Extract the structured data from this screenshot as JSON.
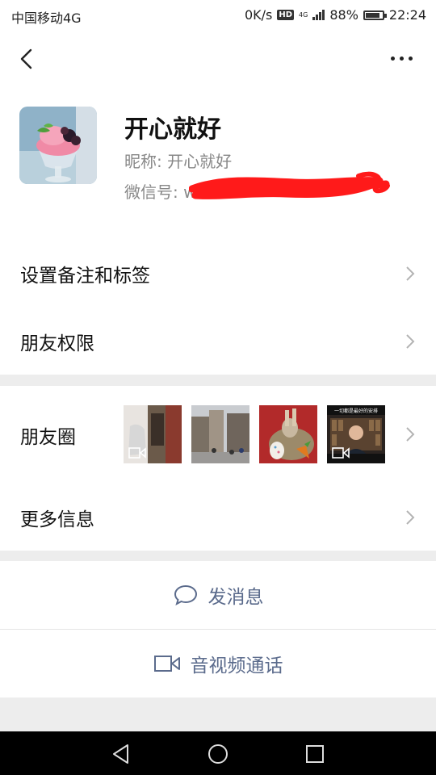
{
  "status_bar": {
    "carrier": "中国移动4G",
    "speed": "0K/s",
    "hd": "HD",
    "network": "4G",
    "battery": "88%",
    "time": "22:24"
  },
  "profile": {
    "name": "开心就好",
    "nickname_label": "昵称:",
    "nickname": "开心就好",
    "wechat_id_label": "微信号:",
    "wechat_id": "w"
  },
  "menu": {
    "remark_tags": "设置备注和标签",
    "friend_permissions": "朋友权限",
    "moments": "朋友圈",
    "more_info": "更多信息"
  },
  "moments_thumb_4_text": "一切都是最好的安排",
  "actions": {
    "send_message": "发消息",
    "video_call": "音视频通话"
  },
  "colors": {
    "link_blue": "#5b6b8c",
    "redaction": "#ff1a1a"
  }
}
